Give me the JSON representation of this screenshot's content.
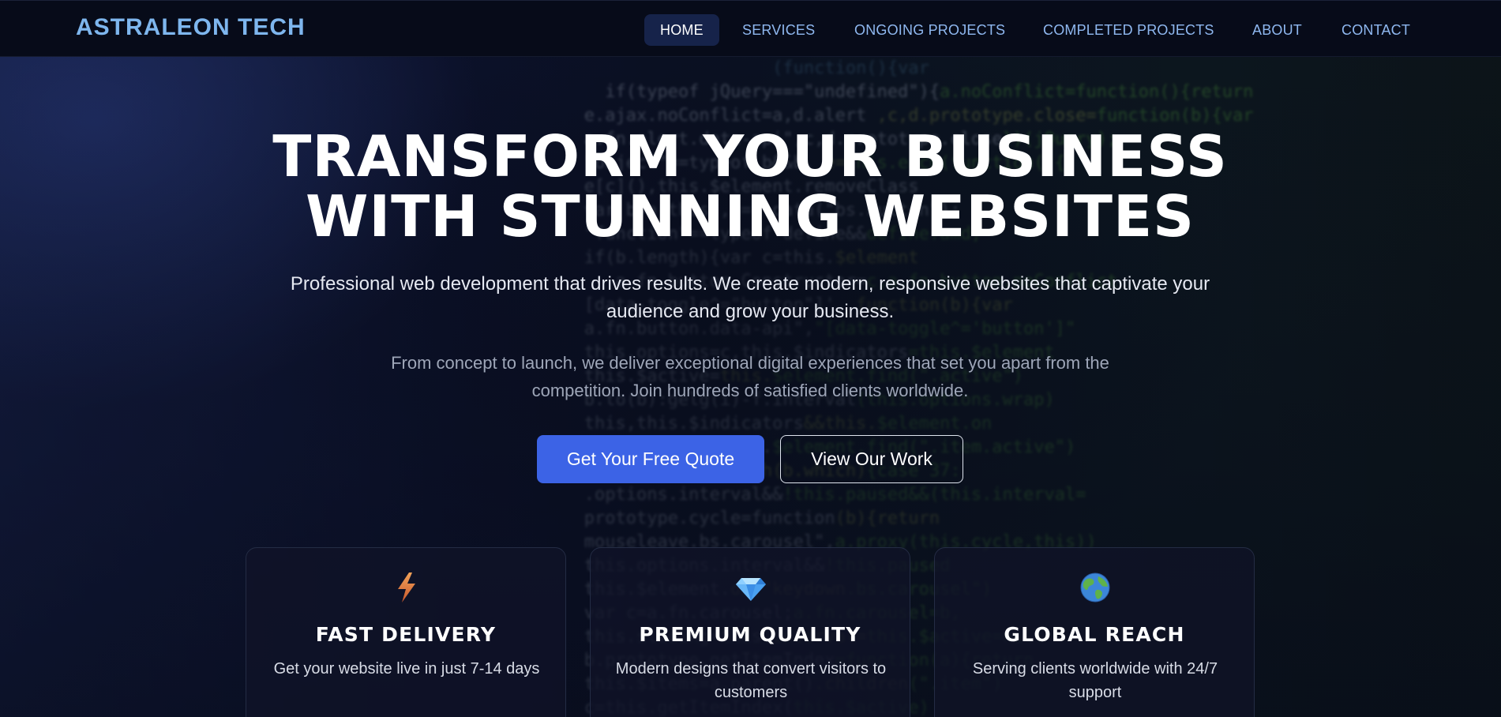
{
  "brand": "ASTRALEON TECH",
  "nav": {
    "items": [
      {
        "label": "HOME",
        "active": true
      },
      {
        "label": "SERVICES"
      },
      {
        "label": "ONGOING PROJECTS"
      },
      {
        "label": "COMPLETED PROJECTS"
      },
      {
        "label": "ABOUT"
      },
      {
        "label": "CONTACT"
      }
    ]
  },
  "hero": {
    "title_line1": "TRANSFORM YOUR BUSINESS",
    "title_line2": "WITH STUNNING WEBSITES",
    "subtitle": "Professional web development that drives results. We create modern, responsive websites that captivate your audience and grow your business.",
    "subtitle2": "From concept to launch, we deliver exceptional digital experiences that set you apart from the competition. Join hundreds of satisfied clients worldwide.",
    "primary_button": "Get Your Free Quote",
    "secondary_button": "View Our Work"
  },
  "features": [
    {
      "icon": "lightning-icon",
      "title": "FAST DELIVERY",
      "text": "Get your website live in just 7-14 days"
    },
    {
      "icon": "diamond-icon",
      "title": "PREMIUM QUALITY",
      "text": "Modern designs that convert visitors to customers"
    },
    {
      "icon": "globe-icon",
      "title": "GLOBAL REACH",
      "text": "Serving clients worldwide with 24/7 support"
    }
  ],
  "colors": {
    "accent": "#3c63e6",
    "brand": "#7eb6ee",
    "nav_link": "#8fb8f0",
    "nav_active_bg": "#16234a"
  }
}
